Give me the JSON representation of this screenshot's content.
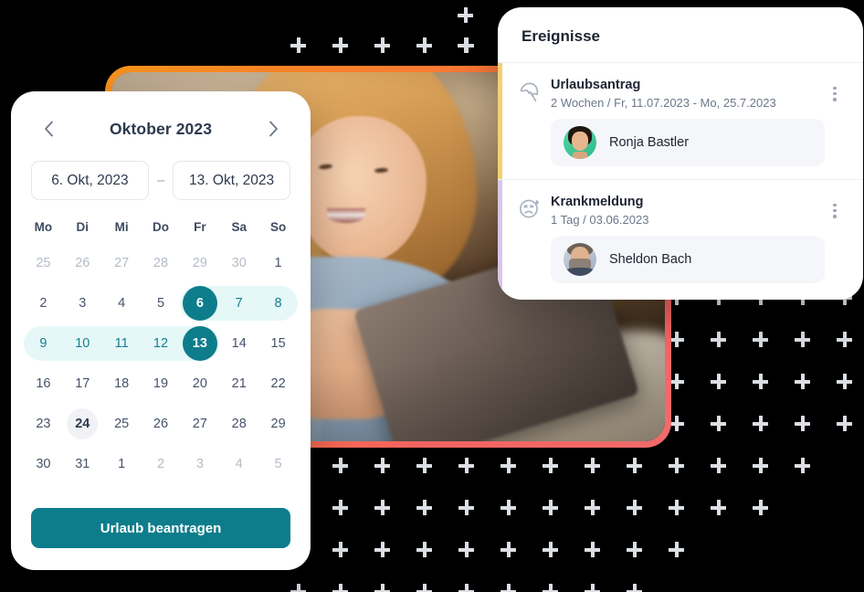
{
  "theme": {
    "accent": "#0e7d8b",
    "range_fill": "#e6f7f8",
    "page_bg": "#000000",
    "plus_color": "#dcdfe4",
    "photo_border_gradient_start": "#f7941d",
    "photo_border_gradient_end": "#f06b6b",
    "event1_accent": "#f7cf73",
    "event2_accent": "#d9c7ea"
  },
  "calendar": {
    "prev_label": "‹",
    "next_label": "›",
    "title": "Oktober 2023",
    "start_date": "6. Okt, 2023",
    "end_date": "13. Okt, 2023",
    "range_separator": "–",
    "weekdays": [
      "Mo",
      "Di",
      "Mi",
      "Do",
      "Fr",
      "Sa",
      "So"
    ],
    "weeks": [
      [
        {
          "n": "25",
          "state": "muted"
        },
        {
          "n": "26",
          "state": "muted"
        },
        {
          "n": "27",
          "state": "muted"
        },
        {
          "n": "28",
          "state": "muted"
        },
        {
          "n": "29",
          "state": "muted"
        },
        {
          "n": "30",
          "state": "muted"
        },
        {
          "n": "1",
          "state": "normal"
        }
      ],
      [
        {
          "n": "2",
          "state": "normal"
        },
        {
          "n": "3",
          "state": "normal"
        },
        {
          "n": "4",
          "state": "normal"
        },
        {
          "n": "5",
          "state": "normal"
        },
        {
          "n": "6",
          "state": "endpoint"
        },
        {
          "n": "7",
          "state": "in-range"
        },
        {
          "n": "8",
          "state": "in-range"
        }
      ],
      [
        {
          "n": "9",
          "state": "in-range"
        },
        {
          "n": "10",
          "state": "in-range"
        },
        {
          "n": "11",
          "state": "in-range"
        },
        {
          "n": "12",
          "state": "in-range"
        },
        {
          "n": "13",
          "state": "endpoint"
        },
        {
          "n": "14",
          "state": "normal"
        },
        {
          "n": "15",
          "state": "normal"
        }
      ],
      [
        {
          "n": "16",
          "state": "normal"
        },
        {
          "n": "17",
          "state": "normal"
        },
        {
          "n": "18",
          "state": "normal"
        },
        {
          "n": "19",
          "state": "normal"
        },
        {
          "n": "20",
          "state": "normal"
        },
        {
          "n": "21",
          "state": "normal"
        },
        {
          "n": "22",
          "state": "normal"
        }
      ],
      [
        {
          "n": "23",
          "state": "normal"
        },
        {
          "n": "24",
          "state": "today"
        },
        {
          "n": "25",
          "state": "normal"
        },
        {
          "n": "26",
          "state": "normal"
        },
        {
          "n": "27",
          "state": "normal"
        },
        {
          "n": "28",
          "state": "normal"
        },
        {
          "n": "29",
          "state": "normal"
        }
      ],
      [
        {
          "n": "30",
          "state": "normal"
        },
        {
          "n": "31",
          "state": "normal"
        },
        {
          "n": "1",
          "state": "normal"
        },
        {
          "n": "2",
          "state": "muted"
        },
        {
          "n": "3",
          "state": "muted"
        },
        {
          "n": "4",
          "state": "muted"
        },
        {
          "n": "5",
          "state": "muted"
        }
      ]
    ],
    "apply_button": "Urlaub beantragen"
  },
  "events_panel": {
    "title": "Ereignisse",
    "events": [
      {
        "icon": "beach-umbrella-icon",
        "name": "Urlaubsantrag",
        "meta": "2 Wochen /  Fr, 11.07.2023 -  Mo, 25.7.2023",
        "person": "Ronja Bastler",
        "accent": "#f7cf73",
        "menu": "more-options"
      },
      {
        "icon": "sick-face-icon",
        "name": "Krankmeldung",
        "meta": "1 Tag / 03.06.2023",
        "person": "Sheldon Bach",
        "accent": "#d9c7ea",
        "menu": "more-options"
      }
    ]
  }
}
